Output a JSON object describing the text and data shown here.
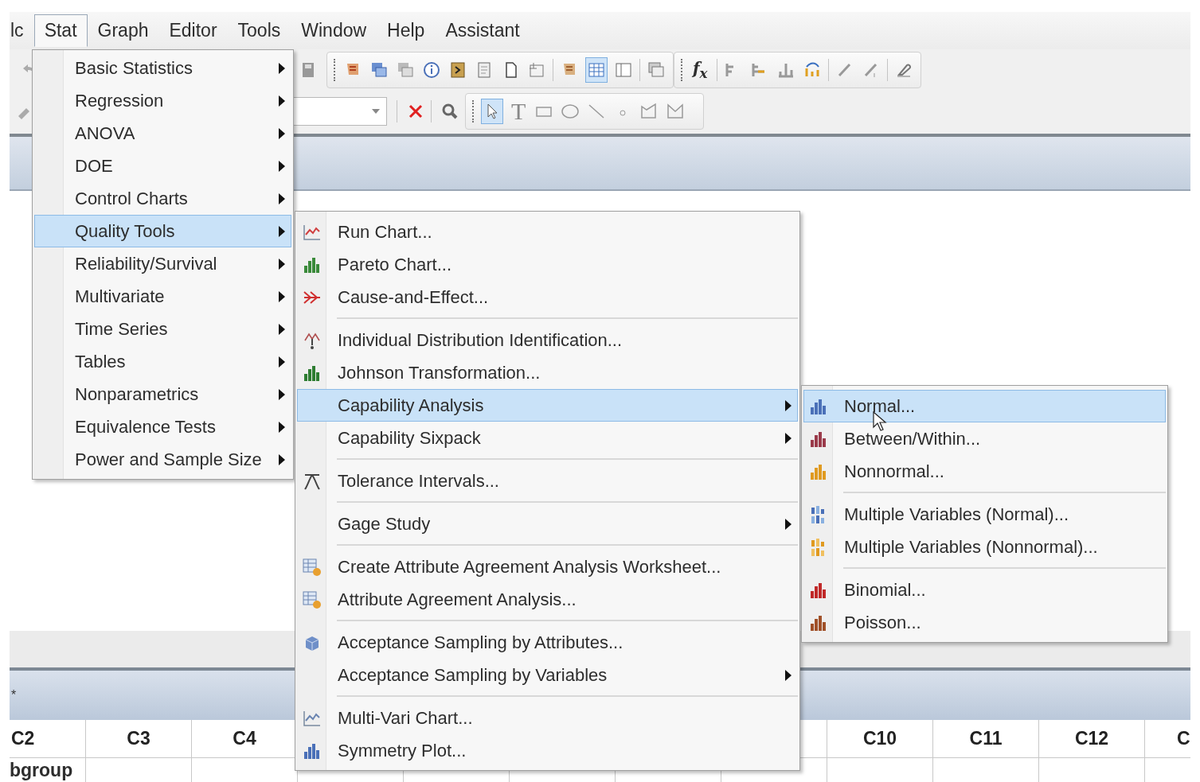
{
  "menubar": [
    {
      "label": "lc",
      "selected": false
    },
    {
      "label": "Stat",
      "selected": true
    },
    {
      "label": "Graph",
      "selected": false
    },
    {
      "label": "Editor",
      "selected": false
    },
    {
      "label": "Tools",
      "selected": false
    },
    {
      "label": "Window",
      "selected": false
    },
    {
      "label": "Help",
      "selected": false
    },
    {
      "label": "Assistant",
      "selected": false
    }
  ],
  "toolbar": {
    "formula_button": "f$_{x}$",
    "text_tool": "T"
  },
  "worksheet": {
    "title": "*",
    "columns_left": [
      "C2",
      "C3",
      "C4"
    ],
    "columns_right": [
      "C10",
      "C11",
      "C12",
      "C"
    ],
    "row_1": "bgroup"
  },
  "stat_menu": [
    {
      "kind": "item",
      "label": "Basic Statistics",
      "selected": false,
      "submenu": true
    },
    {
      "kind": "item",
      "label": "Regression",
      "selected": false,
      "submenu": true
    },
    {
      "kind": "item",
      "label": "ANOVA",
      "selected": false,
      "submenu": true
    },
    {
      "kind": "item",
      "label": "DOE",
      "selected": false,
      "submenu": true
    },
    {
      "kind": "item",
      "label": "Control Charts",
      "selected": false,
      "submenu": true
    },
    {
      "kind": "item",
      "label": "Quality Tools",
      "selected": true,
      "submenu": true
    },
    {
      "kind": "item",
      "label": "Reliability/Survival",
      "selected": false,
      "submenu": true
    },
    {
      "kind": "item",
      "label": "Multivariate",
      "selected": false,
      "submenu": true
    },
    {
      "kind": "item",
      "label": "Time Series",
      "selected": false,
      "submenu": true
    },
    {
      "kind": "item",
      "label": "Tables",
      "selected": false,
      "submenu": true
    },
    {
      "kind": "item",
      "label": "Nonparametrics",
      "selected": false,
      "submenu": true
    },
    {
      "kind": "item",
      "label": "Equivalence Tests",
      "selected": false,
      "submenu": true
    },
    {
      "kind": "item",
      "label": "Power and Sample Size",
      "selected": false,
      "submenu": true
    }
  ],
  "quality_tools_menu": [
    {
      "kind": "item",
      "label": "Run Chart...",
      "selected": false,
      "submenu": false
    },
    {
      "kind": "item",
      "label": "Pareto Chart...",
      "selected": false,
      "submenu": false
    },
    {
      "kind": "item",
      "label": "Cause-and-Effect...",
      "selected": false,
      "submenu": false
    },
    {
      "kind": "separator"
    },
    {
      "kind": "item",
      "label": "Individual Distribution Identification...",
      "selected": false,
      "submenu": false
    },
    {
      "kind": "item",
      "label": "Johnson Transformation...",
      "selected": false,
      "submenu": false
    },
    {
      "kind": "item",
      "label": "Capability Analysis",
      "selected": true,
      "submenu": true
    },
    {
      "kind": "item",
      "label": "Capability Sixpack",
      "selected": false,
      "submenu": true
    },
    {
      "kind": "separator"
    },
    {
      "kind": "item",
      "label": "Tolerance Intervals...",
      "selected": false,
      "submenu": false
    },
    {
      "kind": "separator"
    },
    {
      "kind": "item",
      "label": "Gage Study",
      "selected": false,
      "submenu": true
    },
    {
      "kind": "separator"
    },
    {
      "kind": "item",
      "label": "Create Attribute Agreement Analysis Worksheet...",
      "selected": false,
      "submenu": false
    },
    {
      "kind": "item",
      "label": "Attribute Agreement Analysis...",
      "selected": false,
      "submenu": false
    },
    {
      "kind": "separator"
    },
    {
      "kind": "item",
      "label": "Acceptance Sampling by Attributes...",
      "selected": false,
      "submenu": false
    },
    {
      "kind": "item",
      "label": "Acceptance Sampling by Variables",
      "selected": false,
      "submenu": true
    },
    {
      "kind": "separator"
    },
    {
      "kind": "item",
      "label": "Multi-Vari Chart...",
      "selected": false,
      "submenu": false
    },
    {
      "kind": "item",
      "label": "Symmetry Plot...",
      "selected": false,
      "submenu": false
    }
  ],
  "capability_menu": [
    {
      "kind": "item",
      "label": "Normal...",
      "selected": true,
      "submenu": false
    },
    {
      "kind": "item",
      "label": "Between/Within...",
      "selected": false,
      "submenu": false
    },
    {
      "kind": "item",
      "label": "Nonnormal...",
      "selected": false,
      "submenu": false
    },
    {
      "kind": "separator"
    },
    {
      "kind": "item",
      "label": "Multiple Variables (Normal)...",
      "selected": false,
      "submenu": false
    },
    {
      "kind": "item",
      "label": "Multiple Variables (Nonnormal)...",
      "selected": false,
      "submenu": false
    },
    {
      "kind": "separator"
    },
    {
      "kind": "item",
      "label": "Binomial...",
      "selected": false,
      "submenu": false
    },
    {
      "kind": "item",
      "label": "Poisson...",
      "selected": false,
      "submenu": false
    }
  ]
}
